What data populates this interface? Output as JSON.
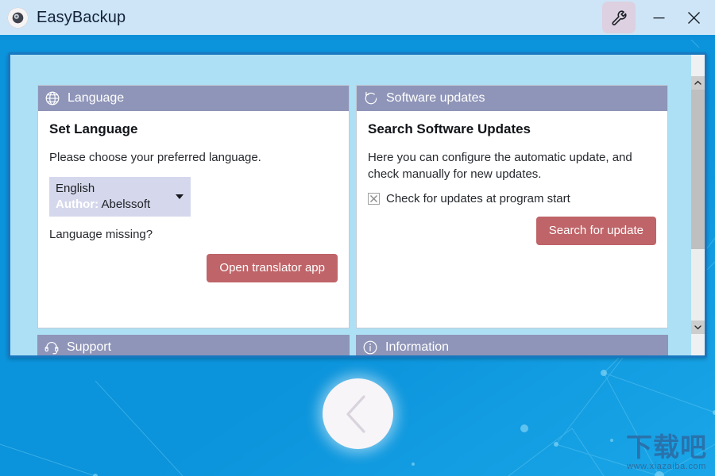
{
  "window": {
    "title": "EasyBackup",
    "app_icon": "lifebuoy-icon",
    "controls": {
      "settings_label": "wrench-icon",
      "minimize_label": "minimize-icon",
      "close_label": "close-icon"
    },
    "colors": {
      "titlebar_bg": "#cde5f6",
      "accent_blue": "#0b8fd8",
      "desktop_bg": "#0b93db",
      "panel_bg": "#ade0f4",
      "card_header": "#8f95b8",
      "card_body": "#ffffff",
      "button_red": "#bf6468",
      "select_bg": "#d5d8ec",
      "wrench_btn_bg": "#ddd0e0"
    }
  },
  "cards": [
    {
      "id": "language",
      "icon": "globe-icon",
      "header": "Language",
      "heading": "Set Language",
      "paragraph": "Please choose your preferred language.",
      "select": {
        "name": "select-language",
        "value": "English",
        "author_label": "Author:",
        "author_value": "Abelssoft"
      },
      "missing_text": "Language missing?",
      "button": "Open translator app"
    },
    {
      "id": "software-updates",
      "icon": "refresh-icon",
      "header": "Software updates",
      "heading": "Search Software Updates",
      "paragraph": "Here you can configure the automatic update, and check manually for new updates.",
      "checkbox": {
        "label": "Check for updates at program start",
        "checked": true,
        "mark": "×"
      },
      "button": "Search for update"
    },
    {
      "id": "support",
      "icon": "headset-icon",
      "header": "Support"
    },
    {
      "id": "information",
      "icon": "info-circle-icon",
      "header": "Information"
    }
  ],
  "scrollbar": {
    "up_label": "scroll-up",
    "down_label": "scroll-down"
  },
  "footer": {
    "back_button": "back-chevron-icon"
  },
  "watermark": {
    "main": "下载吧",
    "sub": "www.xiazaiba.com"
  }
}
